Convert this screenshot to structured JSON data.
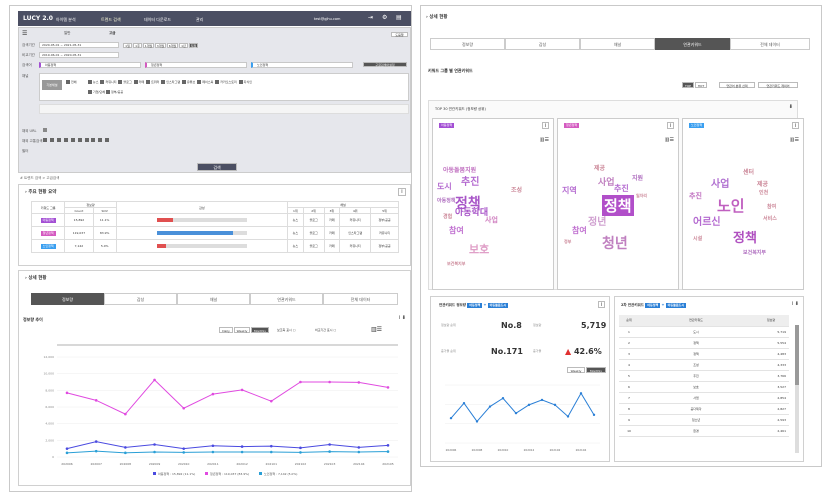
{
  "header": {
    "logo": "LUCY 2.0",
    "nav": [
      "아이템 분석",
      "트렌드 검색",
      "데이터 다운로드",
      "관리"
    ],
    "user_email": "test@gjhu.com"
  },
  "filter": {
    "period_label": "검색기간",
    "period_value": "2020-05-01 ~ 2021-05-31",
    "compare_label": "비교기간",
    "compare_value": "2019-06-01 ~ 2020-05-31",
    "period_buttons": [
      "1일",
      "1주",
      "1개월",
      "3개월",
      "6개월",
      "1년",
      "직접"
    ],
    "keyword_label": "검색어",
    "keywords": [
      "아동정책",
      "청년정책",
      "노인정책"
    ],
    "add_button": "구글검색어설정",
    "channel_label": "채널",
    "channel_all": "전체",
    "channels": [
      "뉴스",
      "커뮤니티",
      "블로그",
      "카페",
      "트위터",
      "인스타그램",
      "유튜브",
      "페이스북",
      "카카오스토리",
      "지식인"
    ],
    "channel_extra": [
      "기업/단체",
      "정부/공공"
    ],
    "url_label": "채외 URL",
    "exclude_label": "채외 고통검색",
    "filter_label": "필터",
    "search_button": "검색"
  },
  "breadcrumb": "# 트렌드 검색 > 고급검색",
  "summary": {
    "title": "주요 현황 요약",
    "headers": [
      "키워드 그룹",
      "정보량",
      "Count",
      "SOV",
      "감성",
      "채널",
      "1위",
      "2위",
      "3위",
      "4위",
      "5위"
    ],
    "rows": [
      {
        "keyword": "아동정책",
        "count": "15,892",
        "sov": "11.1%",
        "ranks": [
          "뉴스",
          "블로그",
          "카페",
          "커뮤니티",
          "정부/공공"
        ]
      },
      {
        "keyword": "청년정책",
        "count": "119,037",
        "sov": "83.9%",
        "ranks": [
          "뉴스",
          "블로그",
          "카페",
          "인스타그램",
          "커뮤니티"
        ]
      },
      {
        "keyword": "노인정책",
        "count": "7,142",
        "sov": "5.0%",
        "ranks": [
          "뉴스",
          "블로그",
          "카페",
          "커뮤니티",
          "정부/공공"
        ]
      }
    ]
  },
  "detail_left": {
    "title": "상세 현황",
    "tabs": [
      "정보량",
      "감성",
      "채널",
      "연관키워드",
      "전체 데이터"
    ],
    "chart_title": "정보량 추이",
    "toggle": [
      "Daily",
      "Weekly",
      "Monthly"
    ],
    "option_labels": [
      "보조축 표시",
      "비교기간 표시"
    ]
  },
  "chart_data": [
    {
      "type": "line",
      "x": [
        "202006",
        "202007",
        "202008",
        "202009",
        "202010",
        "202011",
        "202012",
        "202101",
        "202102",
        "202103",
        "202104",
        "202105"
      ],
      "series": [
        {
          "name": "아동정책",
          "color": "#4a4ae0",
          "values": [
            1000,
            1850,
            1150,
            1500,
            1000,
            1350,
            1250,
            1300,
            1100,
            1500,
            1150,
            1400
          ]
        },
        {
          "name": "청년정책",
          "color": "#e04ae0",
          "values": [
            7700,
            6800,
            5150,
            9250,
            5850,
            7550,
            8050,
            6700,
            9000,
            9000,
            8950,
            8350
          ]
        },
        {
          "name": "노인정책",
          "color": "#2a9fd6",
          "values": [
            500,
            700,
            500,
            600,
            550,
            600,
            600,
            600,
            550,
            650,
            600,
            650
          ]
        }
      ],
      "legend_text": [
        "아동정책 : 15,892 (11.1%)",
        "청년정책 : 119,037 (83.9%)",
        "노인정책 : 7,142 (5.0%)"
      ],
      "ylim": [
        0,
        12000
      ],
      "yticks": [
        "12,000",
        "10,000",
        "8,000",
        "6,000",
        "4,000",
        "2,000",
        "0"
      ]
    },
    {
      "type": "line",
      "x": [
        "202006",
        "202007",
        "202008",
        "202009",
        "202010",
        "202011",
        "202012",
        "202101",
        "202102",
        "202103",
        "202104",
        "202105"
      ],
      "series": [
        {
          "name": "연관키워드",
          "color": "#2a7fd6",
          "values": [
            1500,
            2400,
            1300,
            2200,
            2700,
            1800,
            2300,
            2600,
            2300,
            1600,
            3000,
            1700
          ]
        }
      ]
    }
  ],
  "detail_right": {
    "title": "상세 현황",
    "tabs": [
      "정보량",
      "감성",
      "채널",
      "연관키워드",
      "전체 데이터"
    ],
    "subtitle": "키워드 그룹 별 연관키워드",
    "buttons": [
      "TOP",
      "HOT",
      "연관어 분류 선택",
      "연관키워드 제외어"
    ],
    "top_label": "TOP 30 연관키워드 (정보량 상위)"
  },
  "wordclouds": [
    {
      "tag": "아동정책",
      "tag_color": "#a34fd4",
      "words": [
        {
          "t": "정책",
          "s": 14,
          "c": "#a855c8"
        },
        {
          "t": "보호",
          "s": 11,
          "c": "#e0a0c8"
        },
        {
          "t": "추진",
          "s": 10,
          "c": "#b46ad0"
        },
        {
          "t": "아동학대",
          "s": 9,
          "c": "#a855c8"
        },
        {
          "t": "아동돌봄지원",
          "s": 6,
          "c": "#c070c0"
        },
        {
          "t": "도시",
          "s": 8,
          "c": "#b46ad0"
        },
        {
          "t": "참여",
          "s": 8,
          "c": "#c070d0"
        },
        {
          "t": "사업",
          "s": 7,
          "c": "#d080c0"
        },
        {
          "t": "조성",
          "s": 6,
          "c": "#c89"
        },
        {
          "t": "경험",
          "s": 5,
          "c": "#c89"
        },
        {
          "t": "아동정책",
          "s": 5,
          "c": "#b070c0"
        },
        {
          "t": "보건복지부",
          "s": 4,
          "c": "#c89"
        }
      ]
    },
    {
      "tag": "청년정책",
      "tag_color": "#d45ac0",
      "words": [
        {
          "t": "정책",
          "s": 15,
          "c": "#fff",
          "bg": "#b14fc9"
        },
        {
          "t": "청년",
          "s": 14,
          "c": "#c080c0"
        },
        {
          "t": "사업",
          "s": 9,
          "c": "#c080c0"
        },
        {
          "t": "지역",
          "s": 8,
          "c": "#b46ad0"
        },
        {
          "t": "추진",
          "s": 8,
          "c": "#b46ad0"
        },
        {
          "t": "참여",
          "s": 8,
          "c": "#c070d0"
        },
        {
          "t": "제공",
          "s": 6,
          "c": "#c89"
        },
        {
          "t": "지원",
          "s": 6,
          "c": "#b070c0"
        },
        {
          "t": "정년",
          "s": 10,
          "c": "#d0a0d0"
        },
        {
          "t": "일자리",
          "s": 4,
          "c": "#c89"
        },
        {
          "t": "정부",
          "s": 4,
          "c": "#c89"
        }
      ]
    },
    {
      "tag": "노인정책",
      "tag_color": "#3a9ff0",
      "words": [
        {
          "t": "노인",
          "s": 15,
          "c": "#c060c0"
        },
        {
          "t": "정책",
          "s": 13,
          "c": "#b050c0"
        },
        {
          "t": "사업",
          "s": 10,
          "c": "#b070d0"
        },
        {
          "t": "어르신",
          "s": 10,
          "c": "#b46ad0"
        },
        {
          "t": "추진",
          "s": 7,
          "c": "#c070c0"
        },
        {
          "t": "센터",
          "s": 6,
          "c": "#c89"
        },
        {
          "t": "제공",
          "s": 6,
          "c": "#c89"
        },
        {
          "t": "시설",
          "s": 5,
          "c": "#c89"
        },
        {
          "t": "참여",
          "s": 5,
          "c": "#c89"
        },
        {
          "t": "서비스",
          "s": 5,
          "c": "#c89"
        },
        {
          "t": "보건복지부",
          "s": 5,
          "c": "#b070c0"
        },
        {
          "t": "인천",
          "s": 5,
          "c": "#c89"
        }
      ]
    }
  ],
  "related_info": {
    "title": "연관키워드 정보량",
    "tag1": "아동정책",
    "tag2": "아동돌봄도시",
    "rank_label": "정보량 순위",
    "rank_value": "No.8",
    "count_label": "정보량",
    "count_value": "5,719",
    "inc_rank_label": "증가율 순위",
    "inc_rank_value": "No.171",
    "inc_label": "증가율",
    "inc_value": "42.6%",
    "toggle": [
      "Weekly",
      "Monthly"
    ]
  },
  "second_rank": {
    "title": "2차 연관키워드",
    "tag1": "아동정책",
    "tag2": "아동돌봄도시",
    "headers": [
      "순위",
      "연관키워드",
      "정보량"
    ],
    "rows": [
      [
        "1",
        "도시",
        "5,719"
      ],
      [
        "2",
        "정책",
        "5,554"
      ],
      [
        "3",
        "정책",
        "4,483"
      ],
      [
        "4",
        "조성",
        "4,333"
      ],
      [
        "5",
        "추진",
        "3,766"
      ],
      [
        "6",
        "보호",
        "3,527"
      ],
      [
        "7",
        "사업",
        "2,854"
      ],
      [
        "8",
        "공다제각",
        "2,827"
      ],
      [
        "9",
        "청소년",
        "2,593"
      ],
      [
        "10",
        "환경",
        "2,461"
      ]
    ]
  }
}
